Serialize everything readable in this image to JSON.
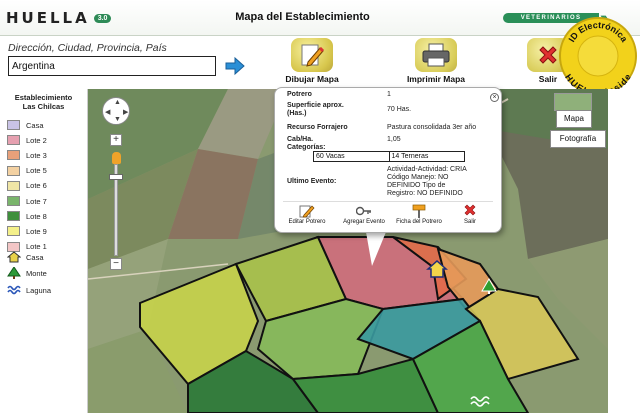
{
  "header": {
    "logo_text": "HUELLA",
    "logo_badge": "3.0",
    "title": "Mapa del Establecimiento",
    "partner": "VETERINARIOS"
  },
  "search": {
    "label": "Dirección, Ciudad, Provincia, País",
    "value": "Argentina"
  },
  "toolbar": {
    "draw_label": "Dibujar Mapa",
    "print_label": "Imprimir Mapa",
    "exit_label": "Salir"
  },
  "seal": {
    "top_text": "ID Electrónica",
    "bottom_text": "HUELLA inside",
    "color": "#f2d21b"
  },
  "sidebar": {
    "title_line1": "Establecimiento",
    "title_line2": "Las Chilcas",
    "items": [
      {
        "label": "Casa",
        "color": "#c9c3e6"
      },
      {
        "label": "Lote 2",
        "color": "#e6a0b0"
      },
      {
        "label": "Lote 3",
        "color": "#e8a07a"
      },
      {
        "label": "Lote 5",
        "color": "#f3d1a2"
      },
      {
        "label": "Lote 6",
        "color": "#f0e6a6"
      },
      {
        "label": "Lote 7",
        "color": "#7ab56c"
      },
      {
        "label": "Lote 8",
        "color": "#3f8f3c"
      },
      {
        "label": "Lote 9",
        "color": "#f4f08a"
      },
      {
        "label": "Lote 1",
        "color": "#f3c6c6"
      }
    ],
    "icon_items": [
      {
        "label": "Casa",
        "icon": "house-icon"
      },
      {
        "label": "Monte",
        "icon": "tree-icon"
      },
      {
        "label": "Laguna",
        "icon": "water-icon"
      }
    ]
  },
  "map": {
    "type_map": "Mapa",
    "type_photo": "Fotografía"
  },
  "popup": {
    "potrero_key": "Potrero",
    "potrero_val": "1",
    "sup_key_line1": "Superficie aprox.",
    "sup_key_line2": "(Has.)",
    "sup_val": "70 Has.",
    "recurso_key": "Recurso Forrajero",
    "recurso_val": "Pastura consolidada 3er año",
    "cab_key": "Cab/Ha.",
    "cab_val": "1,05",
    "cat_key": "Categorías:",
    "categories": [
      "60 Vacas",
      "14 Terneras"
    ],
    "evento_key": "Ultimo Evento:",
    "evento_line1": "Actividad-Actividad: CRIA",
    "evento_line2": "Código Manejo: NO",
    "evento_line3": "DEFINIDO Tipo de",
    "evento_line4": "Registro: NO DEFINIDO",
    "actions": {
      "edit": "Editar Potrero",
      "add_event": "Agregar Evento",
      "record": "Ficha del Potrero",
      "exit": "Salir"
    }
  }
}
